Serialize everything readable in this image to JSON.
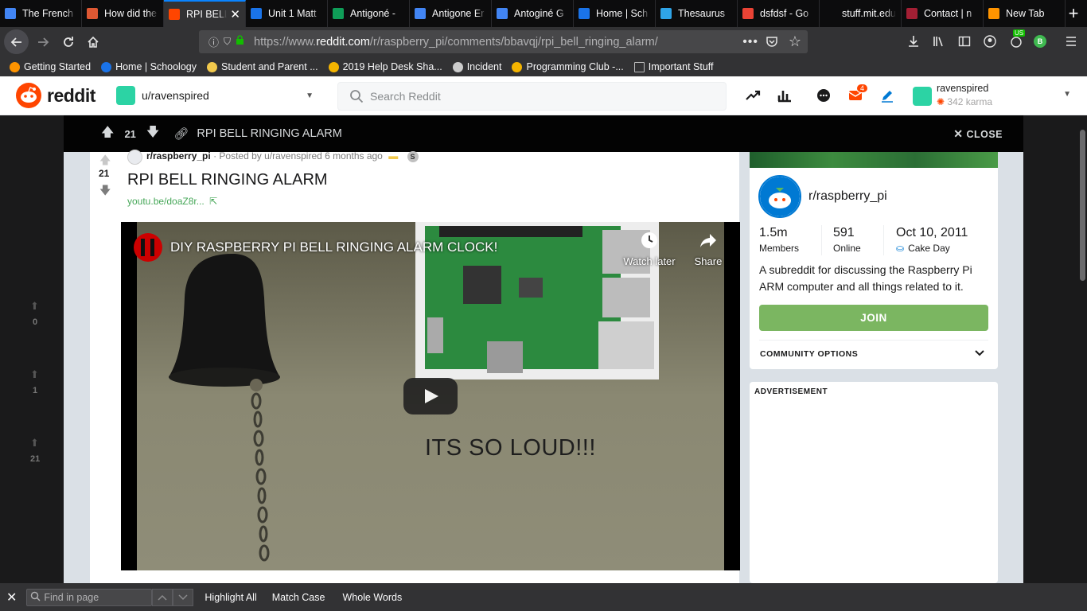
{
  "browser": {
    "tabs": [
      {
        "label": "The French",
        "icon": "google-docs-icon",
        "color": "#4285f4"
      },
      {
        "label": "How did the",
        "icon": "duckduckgo-icon",
        "color": "#de5833"
      },
      {
        "label": "RPI BELL",
        "icon": "reddit-icon",
        "color": "#ff4500",
        "active": true
      },
      {
        "label": "Unit 1 Matt",
        "icon": "schoology-icon",
        "color": "#1a73e8"
      },
      {
        "label": "Antigoné -",
        "icon": "google-drive-icon",
        "color": "#0f9d58"
      },
      {
        "label": "Antigone Er",
        "icon": "google-docs-icon",
        "color": "#4285f4"
      },
      {
        "label": "Antoginé G",
        "icon": "google-docs-icon",
        "color": "#4285f4"
      },
      {
        "label": "Home | Sch",
        "icon": "schoology-icon",
        "color": "#1a73e8"
      },
      {
        "label": "Thesaurus",
        "icon": "thesaurus-icon",
        "color": "#2fa4e7"
      },
      {
        "label": "dsfdsf - Go",
        "icon": "google-icon",
        "color": "#ea4335"
      },
      {
        "label": "stuff.mit.edu/af",
        "icon": "none",
        "color": "#0c0c0d"
      },
      {
        "label": "Contact | n",
        "icon": "mit-icon",
        "color": "#a31f34"
      },
      {
        "label": "New Tab",
        "icon": "firefox-icon",
        "color": "#ff9400"
      }
    ],
    "url_prefix": "https://www.",
    "url_domain": "reddit.com",
    "url_path": "/r/raspberry_pi/comments/bbavqj/rpi_bell_ringing_alarm/",
    "bookmarks": [
      "Getting Started",
      "Home | Schoology",
      "Student and Parent ...",
      "2019 Help Desk Sha...",
      "Incident",
      "Programming Club -...",
      "Important Stuff"
    ],
    "badge_us": "US",
    "profile_letter": "B"
  },
  "reddit": {
    "logo_text": "reddit",
    "user_menu": "u/ravenspired",
    "search_placeholder": "Search Reddit",
    "mail_count": "4",
    "username": "ravenspired",
    "karma": "342 karma"
  },
  "modal": {
    "score": "21",
    "title": "RPI BELL RINGING ALARM",
    "close_label": "CLOSE"
  },
  "post": {
    "subreddit": "r/raspberry_pi",
    "posted_by": "· Posted by u/ravenspired 6 months ago",
    "score": "21",
    "title": "RPI BELL RINGING ALARM",
    "link": "youtu.be/doaZ8r...",
    "video_title": "DIY RASPBERRY PI BELL RINGING ALARM CLOCK!",
    "watch_later": "Watch later",
    "share": "Share",
    "overlay_text": "ITS SO LOUD!!!"
  },
  "sidebar": {
    "name": "r/raspberry_pi",
    "members_value": "1.5m",
    "members_label": "Members",
    "online_value": "591",
    "online_label": "Online",
    "cakeday_value": "Oct 10, 2011",
    "cakeday_label": "Cake Day",
    "description": "A subreddit for discussing the Raspberry Pi ARM computer and all things related to it.",
    "join_label": "JOIN",
    "options_label": "COMMUNITY OPTIONS",
    "ad_label": "ADVERTISEMENT"
  },
  "background": {
    "scores": [
      "0",
      "1",
      "21"
    ]
  },
  "findbar": {
    "placeholder": "Find in page",
    "highlight_all": "Highlight All",
    "match_case": "Match Case",
    "whole_words": "Whole Words"
  },
  "colors": {
    "reddit_orange": "#ff4500",
    "join_green": "#7bb661",
    "link_green": "#46a758",
    "firefox_blue": "#0a84ff"
  }
}
